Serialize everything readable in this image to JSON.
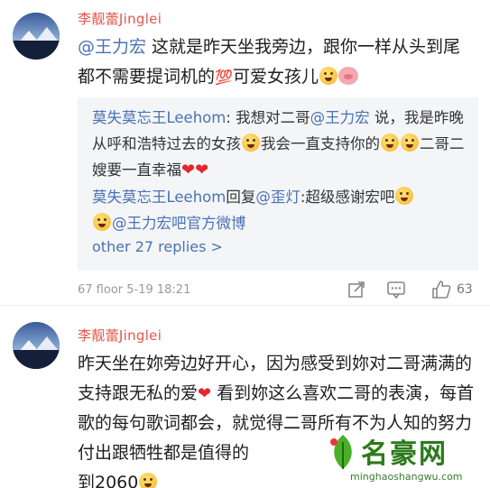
{
  "posts": [
    {
      "username": "李靓蕾Jinglei",
      "text": {
        "mention": "@王力宏",
        "part1": " 这就是昨天坐我旁边，跟你一样从头到尾都不需要提词机的",
        "badge100": "💯",
        "part2": "可爱女孩儿"
      },
      "replies": [
        {
          "author": "莫失莫忘王Leehom",
          "text_a": ": 我想对二哥",
          "mention": "@王力宏",
          "text_b": " 说，我是昨晚从呼和浩特过去的女孩",
          "text_c": "我会一直支持你的",
          "text_d": "二哥二嫂要一直幸福"
        },
        {
          "author": "莫失莫忘王Leehom",
          "reply_word": "回复",
          "mention": "@歪灯",
          "text_a": ":超级感谢宏吧",
          "mention2": "@王力宏吧官方微博"
        }
      ],
      "more_replies": "other 27 replies >",
      "floor_time": "67 floor 5-19 18:21",
      "likes": "63"
    },
    {
      "username": "李靓蕾Jinglei",
      "text": {
        "part1": "昨天坐在妳旁边好开心，因为感受到妳对二哥满满的支持跟无私的爱",
        "part2": " 看到妳这么喜欢二哥的表演，每首歌的每句歌词都会，就觉得二哥所有不为人知的努力付出跟牺牲都是值得的",
        "part3": "到2060"
      }
    }
  ],
  "watermark": {
    "title": "名豪网",
    "url": "minghaoshangwu.com"
  },
  "colors": {
    "username": "#e0584a",
    "link": "#4a72b5",
    "heart": "#e5262e",
    "reply_bg": "#f4f5f7",
    "meta": "#9a9a9a"
  },
  "icons": [
    "avatar",
    "grin-emoji",
    "pig-emoji",
    "scared-emoji",
    "heart-emoji",
    "repost-icon",
    "comment-icon",
    "like-icon"
  ]
}
